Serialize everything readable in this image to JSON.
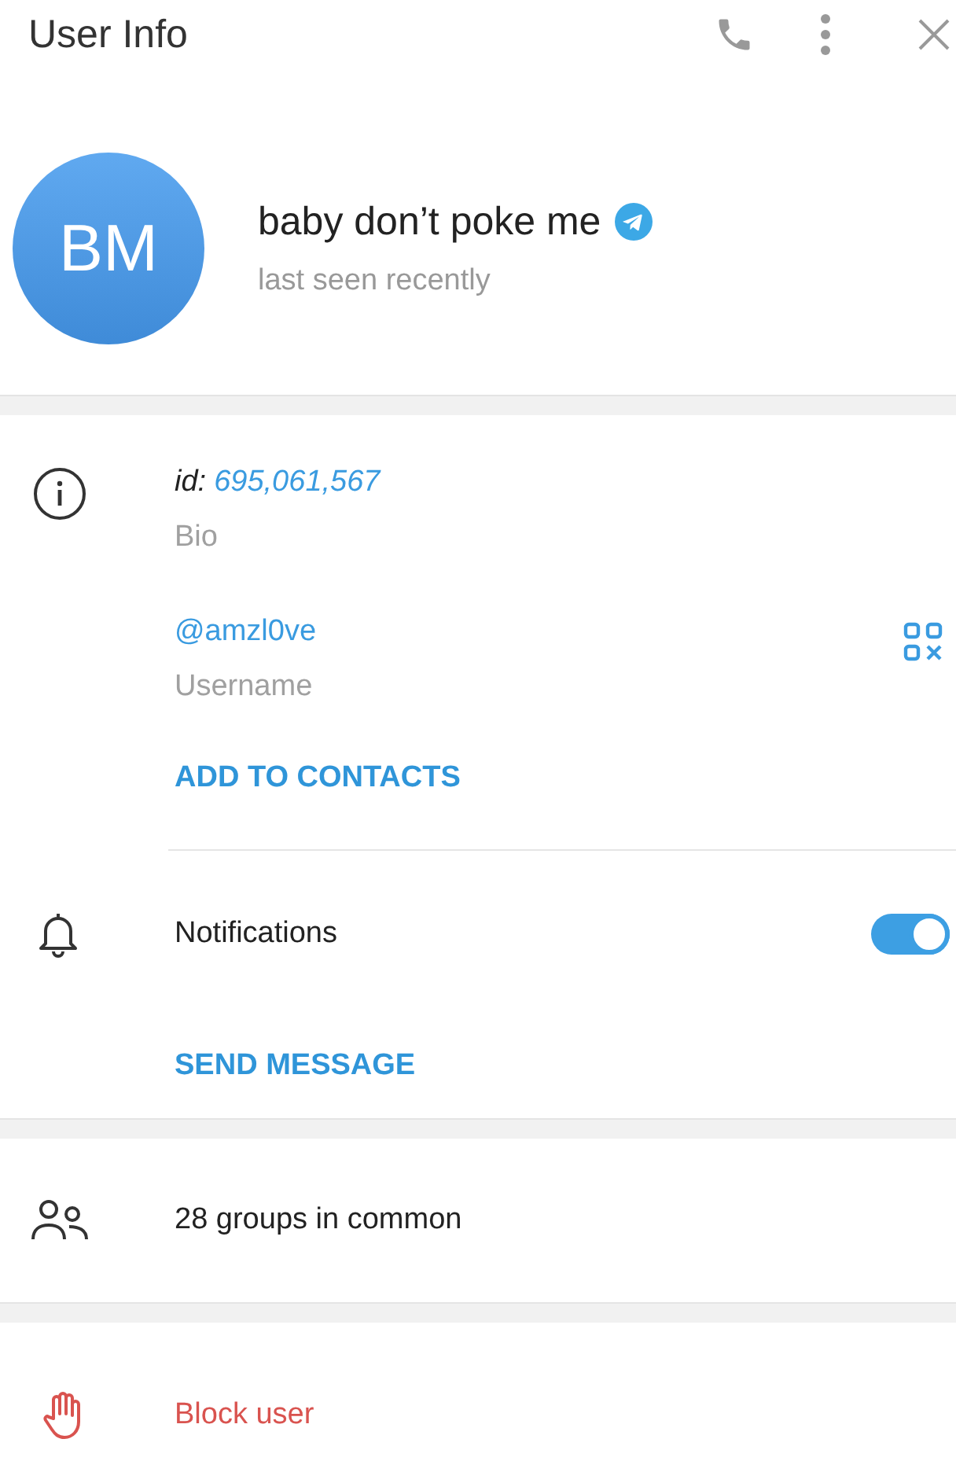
{
  "window": {
    "title": "User Info"
  },
  "profile": {
    "initials": "BM",
    "name": "baby don’t poke me",
    "verified": true,
    "status": "last seen recently"
  },
  "info": {
    "id_label": "id:",
    "id_value": "695,061,567",
    "bio_label": "Bio",
    "username": "@amzl0ve",
    "username_label": "Username",
    "add_contact": "ADD TO CONTACTS"
  },
  "notifications": {
    "label": "Notifications",
    "on": true
  },
  "send_message": "SEND MESSAGE",
  "groups": "28 groups in common",
  "block": "Block user"
}
